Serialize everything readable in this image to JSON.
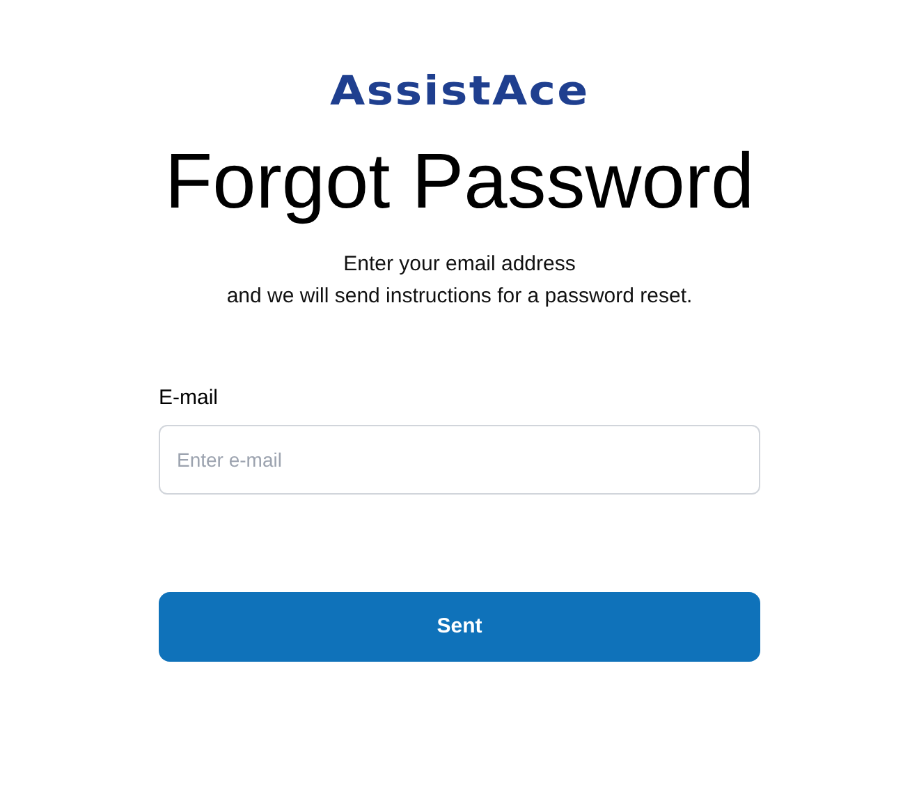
{
  "logo": "AssistAce",
  "title": "Forgot Password",
  "subtitle": [
    "Enter your email address",
    "and we will send instructions for a password reset."
  ],
  "email_field": {
    "label": "E-mail",
    "placeholder": "Enter e-mail"
  },
  "submit_button": "Sent"
}
